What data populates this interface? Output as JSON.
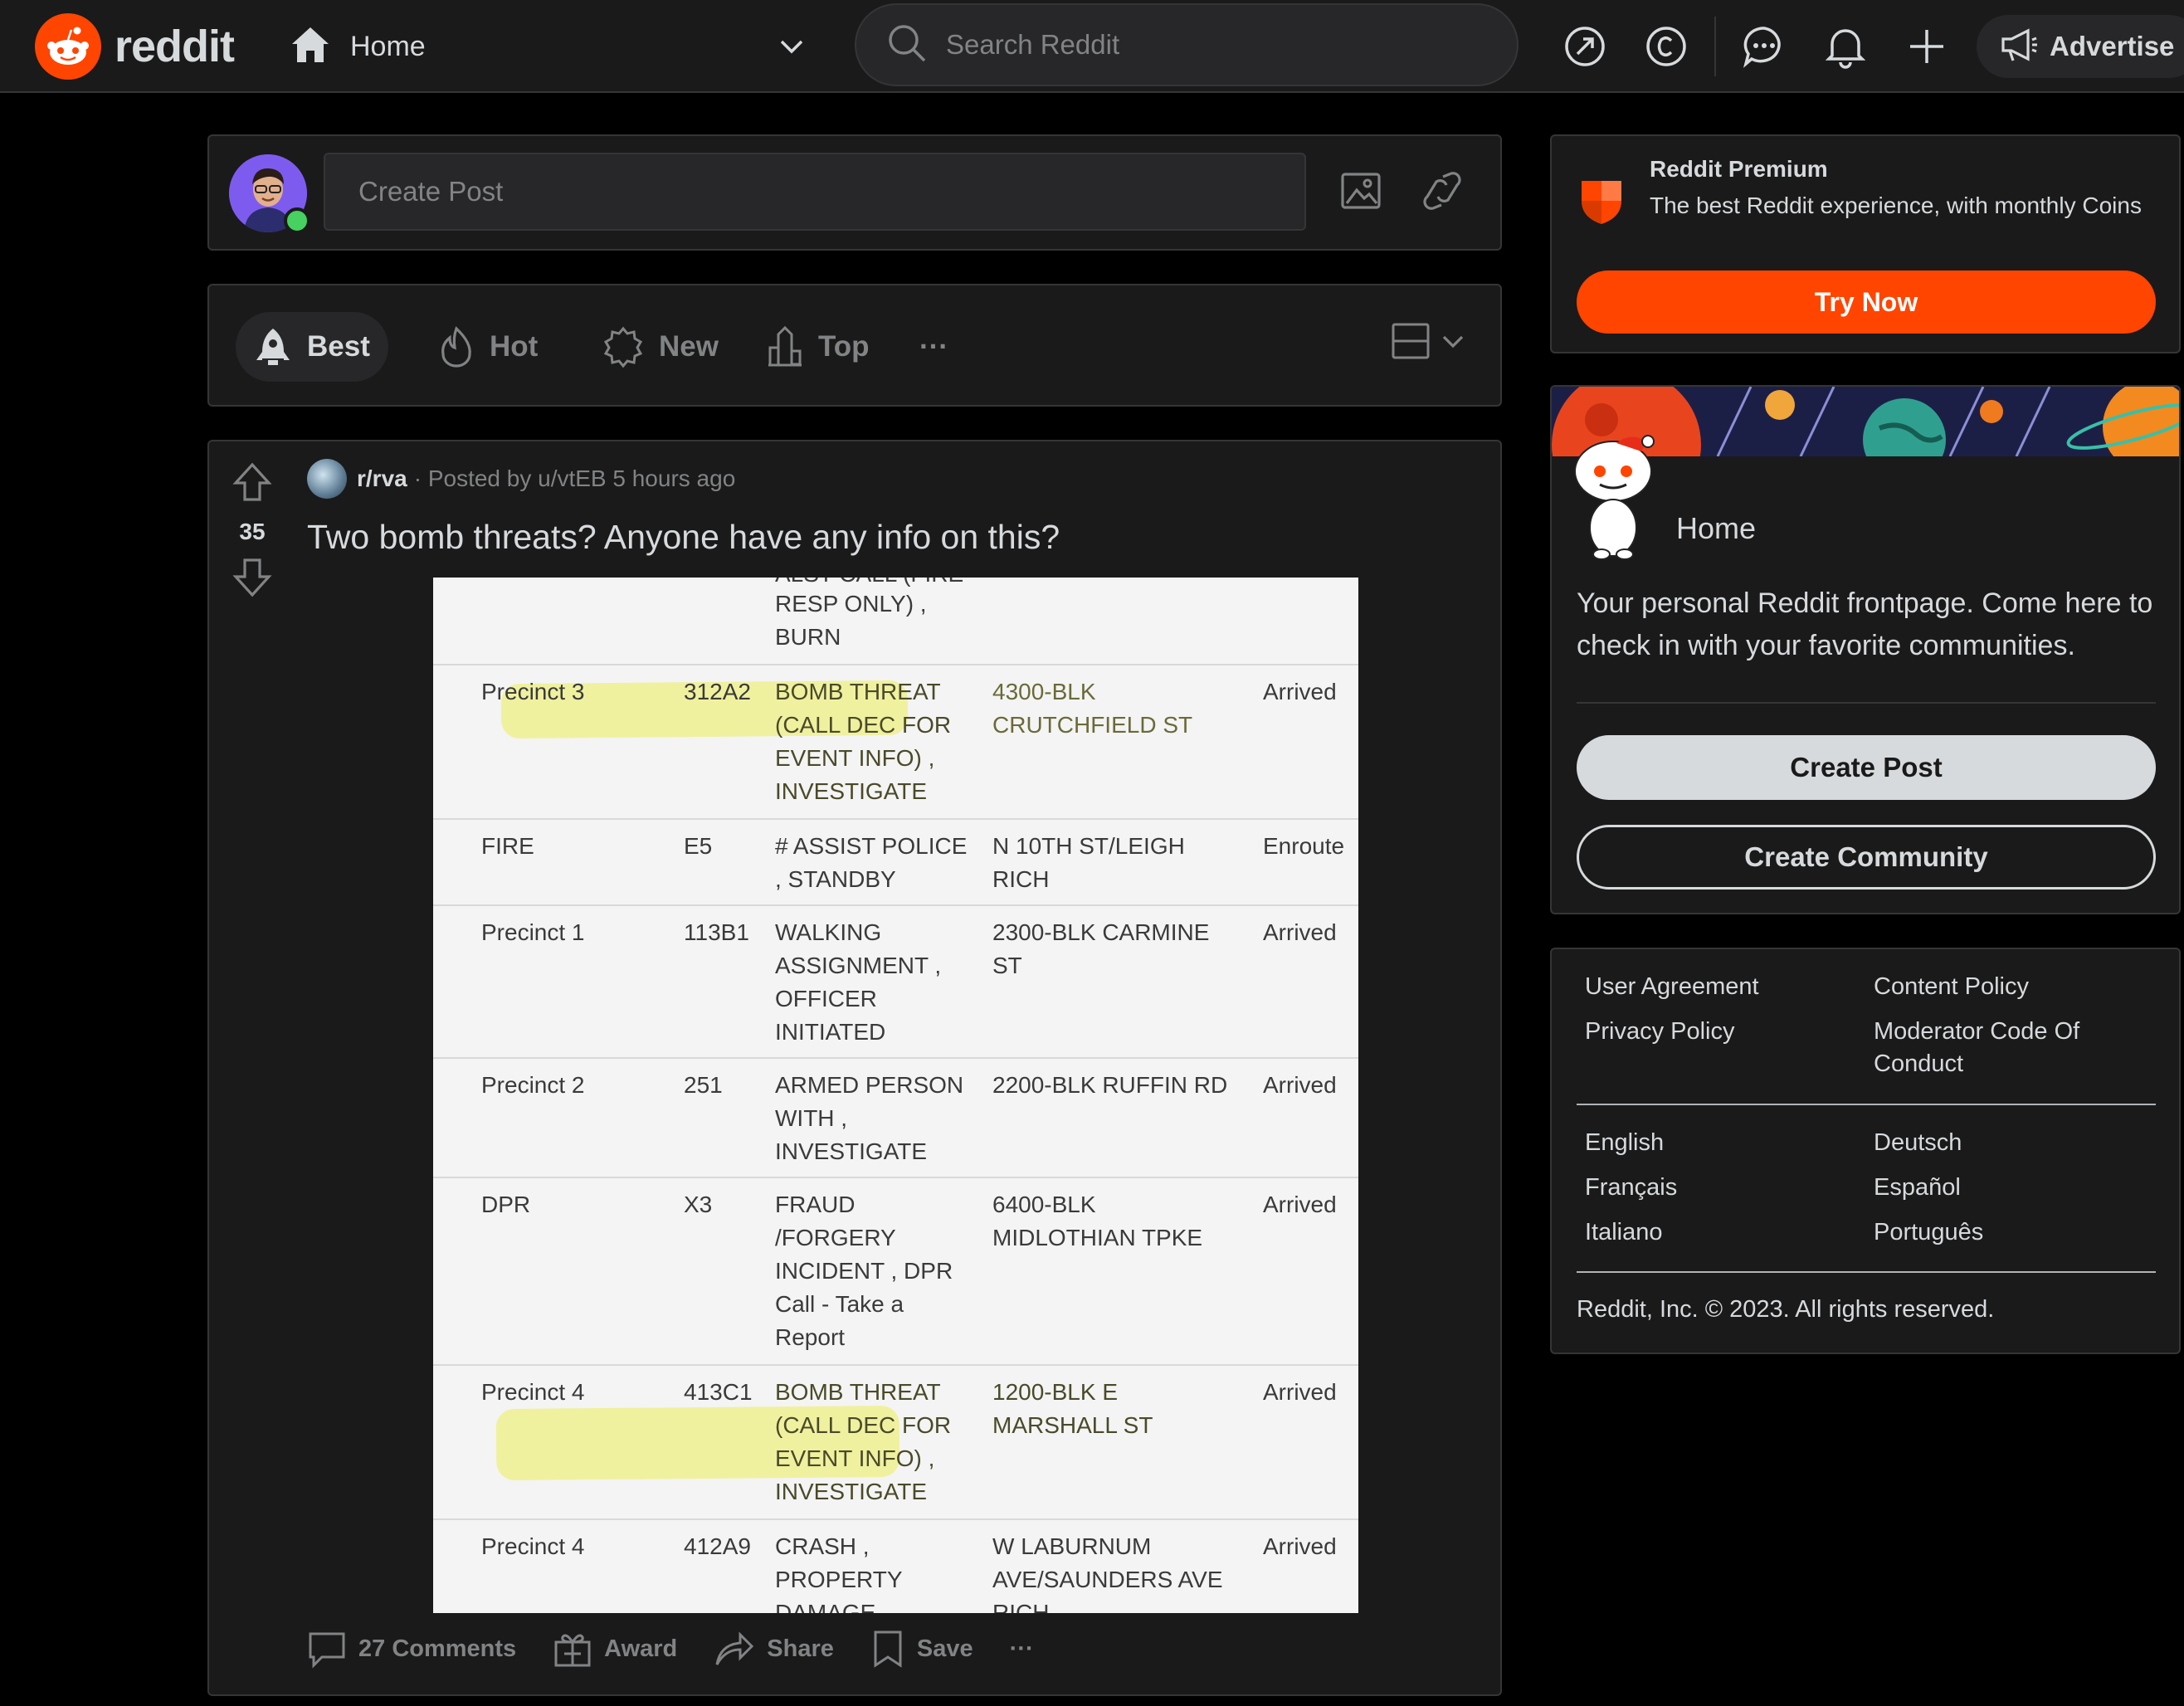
{
  "header": {
    "logo_text": "reddit",
    "feed_label": "Home",
    "search_placeholder": "Search Reddit",
    "advertise_label": "Advertise",
    "brand_color": "#ff4500"
  },
  "create_post": {
    "placeholder": "Create Post"
  },
  "sort": {
    "options": [
      "Best",
      "Hot",
      "New",
      "Top"
    ],
    "active": "Best",
    "more": "···"
  },
  "post": {
    "subreddit": "r/rva",
    "meta": "· Posted by u/vtEB 5 hours ago",
    "votes": "35",
    "title": "Two bomb threats? Anyone have any info on this?",
    "image_rows": [
      {
        "agency": "",
        "unit": "",
        "type": "RESP ONLY) ,\nBURN",
        "location": "",
        "status": ""
      },
      {
        "agency": "Precinct 3",
        "unit": "312A2",
        "type": "BOMB THREAT\n(CALL DEC FOR\nEVENT INFO) ,\nINVESTIGATE",
        "location": "4300-BLK\nCRUTCHFIELD ST",
        "status": "Arrived"
      },
      {
        "agency": "FIRE",
        "unit": "E5",
        "type": "# ASSIST POLICE\n, STANDBY",
        "location": "N 10TH ST/LEIGH\nRICH",
        "status": "Enroute"
      },
      {
        "agency": "Precinct 1",
        "unit": "113B1",
        "type": "WALKING\nASSIGNMENT ,\nOFFICER\nINITIATED",
        "location": "2300-BLK CARMINE\nST",
        "status": "Arrived"
      },
      {
        "agency": "Precinct 2",
        "unit": "251",
        "type": "ARMED PERSON\nWITH ,\nINVESTIGATE",
        "location": "2200-BLK RUFFIN RD",
        "status": "Arrived"
      },
      {
        "agency": "DPR",
        "unit": "X3",
        "type": "FRAUD\n/FORGERY\nINCIDENT , DPR\nCall - Take a\nReport",
        "location": "6400-BLK\nMIDLOTHIAN TPKE",
        "status": "Arrived"
      },
      {
        "agency": "Precinct 4",
        "unit": "413C1",
        "type": "BOMB THREAT\n(CALL DEC FOR\nEVENT INFO) ,\nINVESTIGATE",
        "location": "1200-BLK E\nMARSHALL ST",
        "status": "Arrived"
      },
      {
        "agency": "Precinct 4",
        "unit": "412A9",
        "type": "CRASH ,\nPROPERTY\nDAMAGE",
        "location": "W LABURNUM\nAVE/SAUNDERS AVE\nRICH",
        "status": "Arrived"
      }
    ],
    "actions": {
      "comments": "27 Comments",
      "award": "Award",
      "share": "Share",
      "save": "Save",
      "more": "···"
    }
  },
  "premium": {
    "title": "Reddit Premium",
    "description": "The best Reddit experience, with monthly Coins",
    "button": "Try Now"
  },
  "home_card": {
    "title": "Home",
    "description": "Your personal Reddit frontpage. Come here to check in with your favorite communities.",
    "create_post": "Create Post",
    "create_community": "Create Community"
  },
  "footer": {
    "links": [
      "User Agreement",
      "Content Policy",
      "Privacy Policy",
      "Moderator Code Of Conduct"
    ],
    "languages": [
      "English",
      "Deutsch",
      "Français",
      "Español",
      "Italiano",
      "Português"
    ],
    "copyright": "Reddit, Inc. © 2023. All rights reserved."
  }
}
